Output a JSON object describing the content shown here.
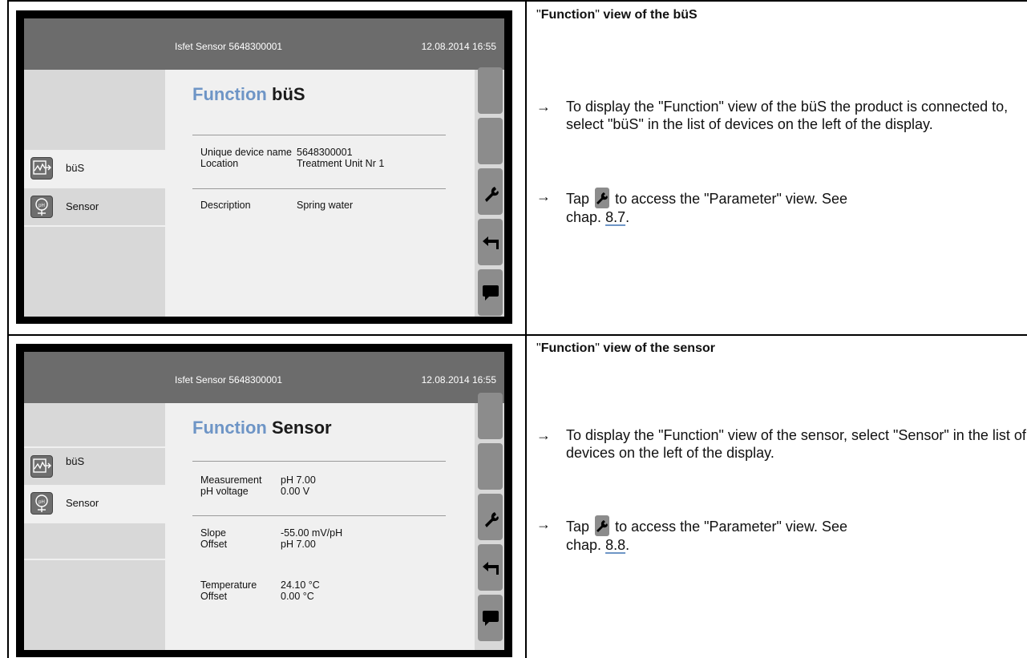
{
  "panels": [
    {
      "screen": {
        "header": {
          "device": "Isfet Sensor 5648300001",
          "datetime": "12.08.2014 16:55"
        },
        "sidebar": [
          {
            "label": "büS",
            "icon": "bus-icon",
            "selected": true
          },
          {
            "label": "Sensor",
            "icon": "sensor-ph-icon",
            "selected": false
          }
        ],
        "title_part1": "Function",
        "title_part2": "büS",
        "groups": [
          [
            {
              "key": "Unique device name",
              "value": "5648300001"
            },
            {
              "key": "Location",
              "value": "Treatment Unit Nr 1"
            }
          ],
          [
            {
              "key": "Description",
              "value": "Spring water"
            }
          ]
        ],
        "buttons": [
          "blank",
          "blank",
          "wrench-icon",
          "back-arrow-icon",
          "message-icon"
        ]
      },
      "description": {
        "title_quote_open": "\"",
        "title_bold1": "Function",
        "title_quote_close": "\"",
        "title_bold2": " view of the büS",
        "para1": "To display the \"Function\" view of the büS the product is connected to, select \"büS\" in the list of devices on the left of the display.",
        "para2_before": "Tap",
        "para2_after": "to access the \"Parameter\" view. See",
        "para2_chap": "chap.",
        "para2_link": "8.7",
        "para2_end": "."
      }
    },
    {
      "screen": {
        "header": {
          "device": "Isfet Sensor 5648300001",
          "datetime": "12.08.2014 16:55"
        },
        "sidebar": [
          {
            "label": "büS",
            "icon": "bus-icon",
            "selected": false
          },
          {
            "label": "Sensor",
            "icon": "sensor-ph-icon",
            "selected": true
          }
        ],
        "title_part1": "Function",
        "title_part2": "Sensor",
        "groups": [
          [
            {
              "key": "Measurement",
              "value": "pH 7.00"
            },
            {
              "key": "pH voltage",
              "value": "0.00 V"
            }
          ],
          [
            {
              "key": "Slope",
              "value": "-55.00 mV/pH"
            },
            {
              "key": "Offset",
              "value": "pH 7.00"
            }
          ],
          [
            {
              "key": "Temperature",
              "value": "24.10 °C"
            },
            {
              "key": "Offset",
              "value": "0.00 °C"
            }
          ]
        ],
        "buttons": [
          "blank",
          "blank",
          "wrench-icon",
          "back-arrow-icon",
          "message-icon"
        ]
      },
      "description": {
        "title_quote_open": "\"",
        "title_bold1": "Function",
        "title_quote_close": "\"",
        "title_bold2": " view of the sensor",
        "para1": "To display the \"Function\" view of the sensor, select \"Sensor\" in the list of devices on the left of the display.",
        "para2_before": "Tap",
        "para2_after": "to access the \"Parameter\" view. See",
        "para2_chap": "chap.",
        "para2_link": "8.8",
        "para2_end": "."
      }
    }
  ],
  "colors": {
    "accent": "#6e95c6",
    "header": "#6c6c6c",
    "button": "#8c8c8c"
  }
}
